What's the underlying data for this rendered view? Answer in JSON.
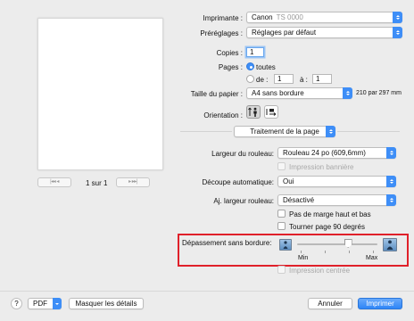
{
  "printer": {
    "label": "Imprimante :",
    "value": "Canon",
    "value_blurred": "TS 0000"
  },
  "presets": {
    "label": "Préréglages :",
    "value": "Réglages par défaut"
  },
  "copies": {
    "label": "Copies :",
    "value": "1"
  },
  "pages": {
    "label": "Pages :",
    "all_label": "toutes",
    "from_label": "de :",
    "from_value": "1",
    "to_label": "à :",
    "to_value": "1"
  },
  "paper_size": {
    "label": "Taille du papier :",
    "value": "A4 sans bordure",
    "dimensions": "210 par 297 mm"
  },
  "orientation": {
    "label": "Orientation :"
  },
  "section": {
    "value": "Traitement de la page"
  },
  "roll_width": {
    "label": "Largeur du rouleau:",
    "value": "Rouleau 24 po (609,6mm)"
  },
  "banner_print": {
    "label": "Impression bannière"
  },
  "auto_cut": {
    "label": "Découpe automatique:",
    "value": "Oui"
  },
  "adjust_roll_width": {
    "label": "Aj. largeur rouleau:",
    "value": "Désactivé"
  },
  "no_margin": {
    "label": "Pas de marge haut et bas"
  },
  "rotate_90": {
    "label": "Tourner page 90 degrés"
  },
  "borderless_overflow": {
    "label": "Dépassement sans bordure:",
    "min_label": "Min",
    "max_label": "Max",
    "level": 0.65
  },
  "centered_print": {
    "label": "Impression centrée"
  },
  "preview_pager": {
    "page_label": "1 sur 1",
    "first": "|◂◂",
    "prev": "◂",
    "next": "▸",
    "last": "▸▸|"
  },
  "bottom": {
    "help": "?",
    "pdf": "PDF",
    "hide_details": "Masquer les détails",
    "cancel": "Annuler",
    "print": "Imprimer"
  }
}
